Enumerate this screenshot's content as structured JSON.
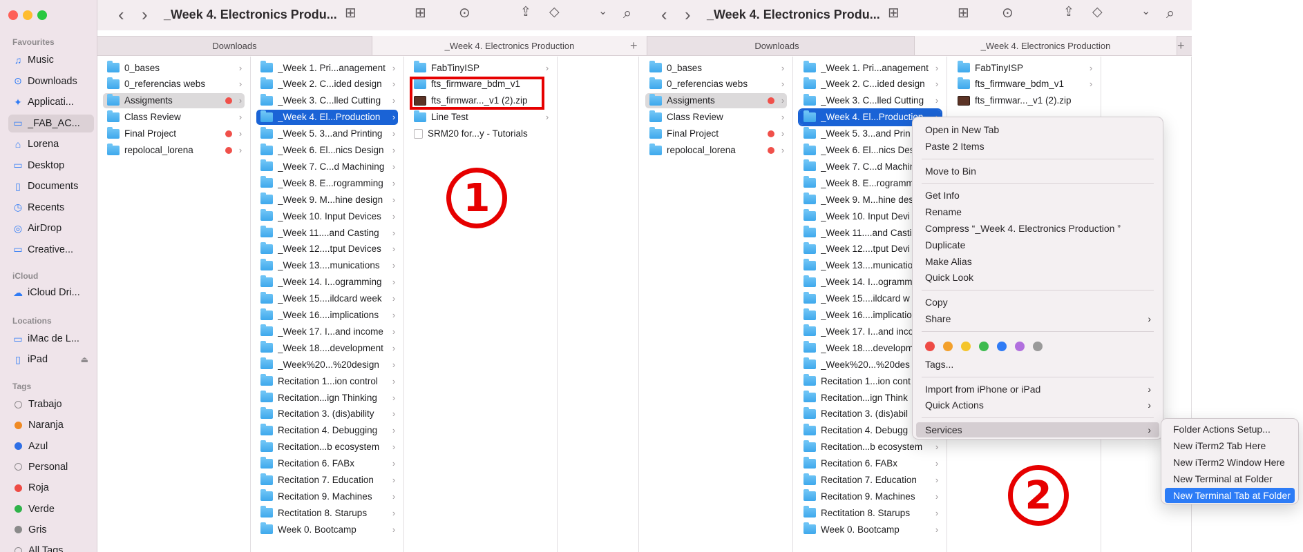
{
  "sidebar": {
    "sections": [
      {
        "header": "Favourites",
        "items": [
          {
            "label": "Music",
            "icon": "music-icon",
            "glyph": "♫"
          },
          {
            "label": "Downloads",
            "icon": "downloads-icon",
            "glyph": "⊙"
          },
          {
            "label": "Applicati...",
            "icon": "applications-icon",
            "glyph": "✦"
          },
          {
            "label": "_FAB_AC...",
            "icon": "folder-icon",
            "glyph": "▭",
            "selected": true
          },
          {
            "label": "Lorena",
            "icon": "home-icon",
            "glyph": "⌂"
          },
          {
            "label": "Desktop",
            "icon": "desktop-icon",
            "glyph": "▭"
          },
          {
            "label": "Documents",
            "icon": "documents-icon",
            "glyph": "▯"
          },
          {
            "label": "Recents",
            "icon": "recents-icon",
            "glyph": "◷"
          },
          {
            "label": "AirDrop",
            "icon": "airdrop-icon",
            "glyph": "◎"
          },
          {
            "label": "Creative...",
            "icon": "folder-icon",
            "glyph": "▭"
          }
        ]
      },
      {
        "header": "iCloud",
        "items": [
          {
            "label": "iCloud Dri...",
            "icon": "icloud-icon",
            "glyph": "☁"
          }
        ]
      },
      {
        "header": "Locations",
        "items": [
          {
            "label": "iMac de L...",
            "icon": "imac-icon",
            "glyph": "▭"
          },
          {
            "label": "iPad",
            "icon": "ipad-icon",
            "glyph": "▯",
            "eject": "⏏"
          }
        ]
      },
      {
        "header": "Tags",
        "items": [
          {
            "label": "Trabajo",
            "color": "",
            "outline": true
          },
          {
            "label": "Naranja",
            "color": "#f08a24"
          },
          {
            "label": "Azul",
            "color": "#2f6fe6"
          },
          {
            "label": "Personal",
            "color": "",
            "outline": true
          },
          {
            "label": "Roja",
            "color": "#ee4b45"
          },
          {
            "label": "Verde",
            "color": "#2fb34a"
          },
          {
            "label": "Gris",
            "color": "#8a8a8a"
          },
          {
            "label": "All Tags...",
            "color": "",
            "outline": true
          }
        ]
      }
    ]
  },
  "windows": [
    {
      "title": "_Week 4. Electronics Produ...",
      "tabs": [
        "Downloads",
        "_Week 4. Electronics Production"
      ],
      "col1": [
        {
          "label": "0_bases"
        },
        {
          "label": "0_referencias webs"
        },
        {
          "label": "Assigments",
          "dot": true,
          "state": "graysel"
        },
        {
          "label": "Class Review"
        },
        {
          "label": "Final Project",
          "dot": true
        },
        {
          "label": "repolocal_lorena",
          "dot": true
        }
      ],
      "col2": [
        {
          "label": "_Week 1. Pri...anagement"
        },
        {
          "label": "_Week 2. C...ided design"
        },
        {
          "label": "_Week 3. C...lled Cutting"
        },
        {
          "label": "_Week 4. El...Production",
          "state": "sel"
        },
        {
          "label": "_Week 5. 3...and Printing"
        },
        {
          "label": "_Week 6. El...nics Design"
        },
        {
          "label": "_Week 7. C...d Machining"
        },
        {
          "label": "_Week 8. E...rogramming"
        },
        {
          "label": "_Week 9. M...hine design"
        },
        {
          "label": "_Week 10. Input Devices"
        },
        {
          "label": "_Week 11....and Casting"
        },
        {
          "label": "_Week 12....tput Devices"
        },
        {
          "label": "_Week 13....munications"
        },
        {
          "label": "_Week 14. I...ogramming"
        },
        {
          "label": "_Week 15....ildcard week"
        },
        {
          "label": "_Week 16....implications"
        },
        {
          "label": "_Week 17. I...and income"
        },
        {
          "label": "_Week 18....development"
        },
        {
          "label": "_Week%20...%20design"
        },
        {
          "label": "Recitation 1...ion control"
        },
        {
          "label": "Recitation...ign Thinking"
        },
        {
          "label": "Recitation 3. (dis)ability"
        },
        {
          "label": "Recitation 4. Debugging"
        },
        {
          "label": "Recitation...b ecosystem"
        },
        {
          "label": "Recitation 6. FABx"
        },
        {
          "label": "Recitation 7. Education"
        },
        {
          "label": "Recitation 9. Machines"
        },
        {
          "label": "Rectitation 8. Starups"
        },
        {
          "label": "Week 0. Bootcamp"
        }
      ],
      "col3": [
        {
          "label": "FabTinyISP",
          "kind": "folder"
        },
        {
          "label": "fts_firmware_bdm_v1",
          "kind": "folder",
          "nochev": true
        },
        {
          "label": "fts_firmwar..._v1 (2).zip",
          "kind": "zip",
          "nochev": true
        },
        {
          "label": "Line Test",
          "kind": "folder"
        },
        {
          "label": "SRM20 for...y - Tutorials",
          "kind": "doc",
          "nochev": true
        }
      ]
    },
    {
      "title": "_Week 4. Electronics Produ...",
      "tabs": [
        "Downloads",
        "_Week 4. Electronics Production"
      ],
      "col1": [
        {
          "label": "0_bases"
        },
        {
          "label": "0_referencias webs"
        },
        {
          "label": "Assigments",
          "dot": true,
          "state": "graysel"
        },
        {
          "label": "Class Review"
        },
        {
          "label": "Final Project",
          "dot": true
        },
        {
          "label": "repolocal_lorena",
          "dot": true
        }
      ],
      "col2": [
        {
          "label": "_Week 1. Pri...anagement"
        },
        {
          "label": "_Week 2. C...ided design"
        },
        {
          "label": "_Week 3. C...lled Cutting"
        },
        {
          "label": "_Week 4. El...Production",
          "state": "outline"
        },
        {
          "label": "_Week 5. 3...and Prin"
        },
        {
          "label": "_Week 6. El...nics Des"
        },
        {
          "label": "_Week 7. C...d Machin"
        },
        {
          "label": "_Week 8. E...rogramm"
        },
        {
          "label": "_Week 9. M...hine des"
        },
        {
          "label": "_Week 10. Input Devi"
        },
        {
          "label": "_Week 11....and Casti"
        },
        {
          "label": "_Week 12....tput Devi"
        },
        {
          "label": "_Week 13....municatio"
        },
        {
          "label": "_Week 14. I...ogramm"
        },
        {
          "label": "_Week 15....ildcard w"
        },
        {
          "label": "_Week 16....implicatio"
        },
        {
          "label": "_Week 17. I...and inco"
        },
        {
          "label": "_Week 18....developm"
        },
        {
          "label": "_Week%20...%20des"
        },
        {
          "label": "Recitation 1...ion cont"
        },
        {
          "label": "Recitation...ign Think"
        },
        {
          "label": "Recitation 3. (dis)abil"
        },
        {
          "label": "Recitation 4. Debugg"
        },
        {
          "label": "Recitation...b ecosystem"
        },
        {
          "label": "Recitation 6. FABx"
        },
        {
          "label": "Recitation 7. Education"
        },
        {
          "label": "Recitation 9. Machines"
        },
        {
          "label": "Rectitation 8. Starups"
        },
        {
          "label": "Week 0. Bootcamp"
        }
      ],
      "col3": [
        {
          "label": "FabTinyISP",
          "kind": "folder"
        },
        {
          "label": "fts_firmware_bdm_v1",
          "kind": "folder"
        },
        {
          "label": "fts_firmwar..._v1 (2).zip",
          "kind": "zip",
          "nochev": true
        },
        {
          "label": "Line Test",
          "kind": "folder",
          "hidden": true
        }
      ]
    }
  ],
  "context_menu": {
    "items": [
      {
        "label": "Open in New Tab"
      },
      {
        "label": "Paste 2 Items"
      },
      {
        "sep": true
      },
      {
        "label": "Move to Bin"
      },
      {
        "sep": true
      },
      {
        "label": "Get Info"
      },
      {
        "label": "Rename"
      },
      {
        "label": "Compress “_Week 4. Electronics Production ”"
      },
      {
        "label": "Duplicate"
      },
      {
        "label": "Make Alias"
      },
      {
        "label": "Quick Look"
      },
      {
        "sep": true
      },
      {
        "label": "Copy"
      },
      {
        "label": "Share",
        "sub": "›"
      },
      {
        "sep": true
      },
      {
        "colors": [
          "#ee4b45",
          "#f3a02b",
          "#f4c52b",
          "#3dbb4f",
          "#2f7bf5",
          "#b16fde",
          "#9a9a9a"
        ]
      },
      {
        "label": "Tags..."
      },
      {
        "sep": true
      },
      {
        "label": "Import from iPhone or iPad",
        "sub": "›"
      },
      {
        "label": "Quick Actions",
        "sub": "›"
      },
      {
        "sep": true
      },
      {
        "label": "Services",
        "sub": "›",
        "highlight": true
      }
    ]
  },
  "services_submenu": [
    {
      "label": "Folder Actions Setup..."
    },
    {
      "label": "New iTerm2 Tab Here"
    },
    {
      "label": "New iTerm2 Window Here"
    },
    {
      "label": "New Terminal at Folder"
    },
    {
      "label": "New Terminal Tab at Folder",
      "highlight": true
    }
  ],
  "annotations": {
    "step1": "1",
    "step2": "2"
  },
  "toolbar_glyphs": {
    "back": "‹",
    "forward": "›",
    "columns": "⊞",
    "grid": "⊞",
    "more": "⊙",
    "share": "⇪",
    "tag": "◇",
    "chevron": "⌄",
    "search": "⌕",
    "plus": "+"
  },
  "colors": {
    "selection": "#1a63d6",
    "annotation_red": "#e60000",
    "submenu_highlight": "#2d7cf6"
  }
}
